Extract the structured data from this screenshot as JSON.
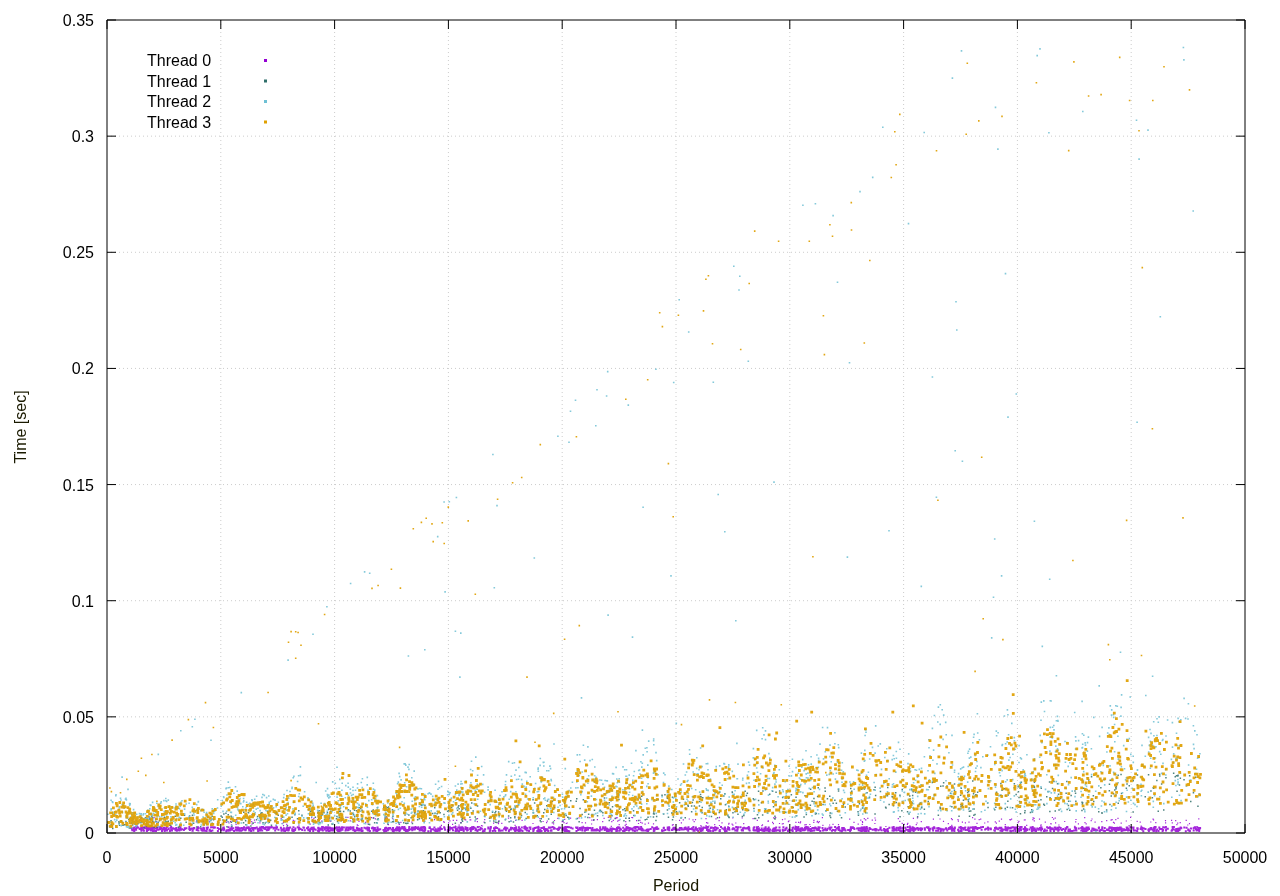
{
  "plot": {
    "y_axis_label": "Time [sec]",
    "x_axis_label": "Period",
    "y_tick_labels": [
      "0.35",
      "0.3",
      "0.25",
      "0.2",
      "0.15",
      "0.1",
      "0.05",
      "0"
    ],
    "x_tick_labels": [
      "0",
      "5000",
      "10000",
      "15000",
      "20000",
      "25000",
      "30000",
      "35000",
      "40000",
      "45000",
      "50000"
    ],
    "legend": [
      {
        "label": "Thread 0",
        "color": "#9400d3"
      },
      {
        "label": "Thread 1",
        "color": "#2f6f6a"
      },
      {
        "label": "Thread 2",
        "color": "#6ec0d4"
      },
      {
        "label": "Thread 3",
        "color": "#e0a000"
      }
    ]
  }
}
